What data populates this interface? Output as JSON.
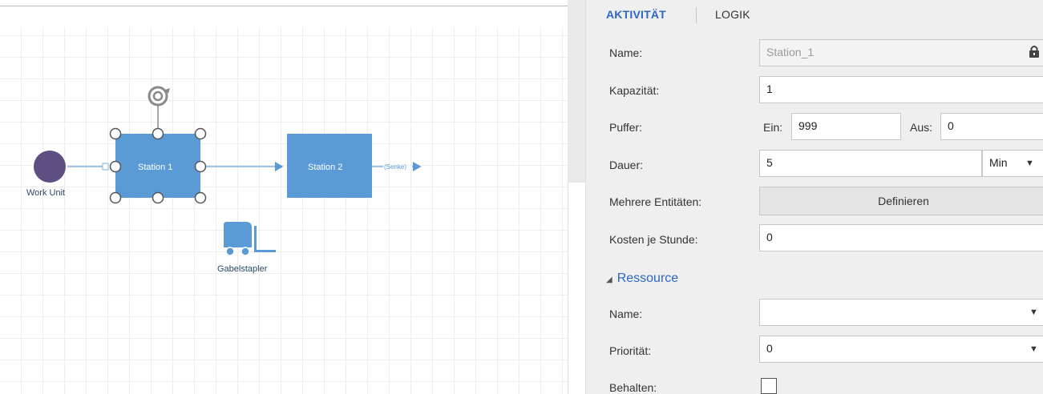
{
  "canvas": {
    "nodes": {
      "work_unit": {
        "caption": "Work Unit"
      },
      "station1": {
        "label": "Station 1"
      },
      "station2": {
        "label": "Station 2"
      },
      "sink": {
        "label": "(Senke)"
      },
      "forklift": {
        "caption": "Gabelstapler"
      }
    }
  },
  "panel": {
    "tabs": {
      "activity": "AKTIVITÄT",
      "logic": "LOGIK"
    },
    "name": {
      "label": "Name:",
      "value": "Station_1"
    },
    "capacity": {
      "label": "Kapazität:",
      "value": "1"
    },
    "buffer": {
      "label": "Puffer:",
      "in_label": "Ein:",
      "in_value": "999",
      "out_label": "Aus:",
      "out_value": "0"
    },
    "duration": {
      "label": "Dauer:",
      "value": "5",
      "unit": "Min"
    },
    "multi_entities": {
      "label": "Mehrere Entitäten:",
      "button": "Definieren"
    },
    "cost": {
      "label": "Kosten je Stunde:",
      "value": "0"
    },
    "resource": {
      "section_title": "Ressource",
      "name_label": "Name:",
      "name_value": "",
      "priority_label": "Priorität:",
      "priority_value": "0",
      "keep_label": "Behalten:",
      "keep_checked": false
    }
  },
  "colors": {
    "station_fill": "#5b9bd5",
    "work_unit_fill": "#5e4f82",
    "accent": "#2c66c7",
    "grid": "#dedede"
  }
}
